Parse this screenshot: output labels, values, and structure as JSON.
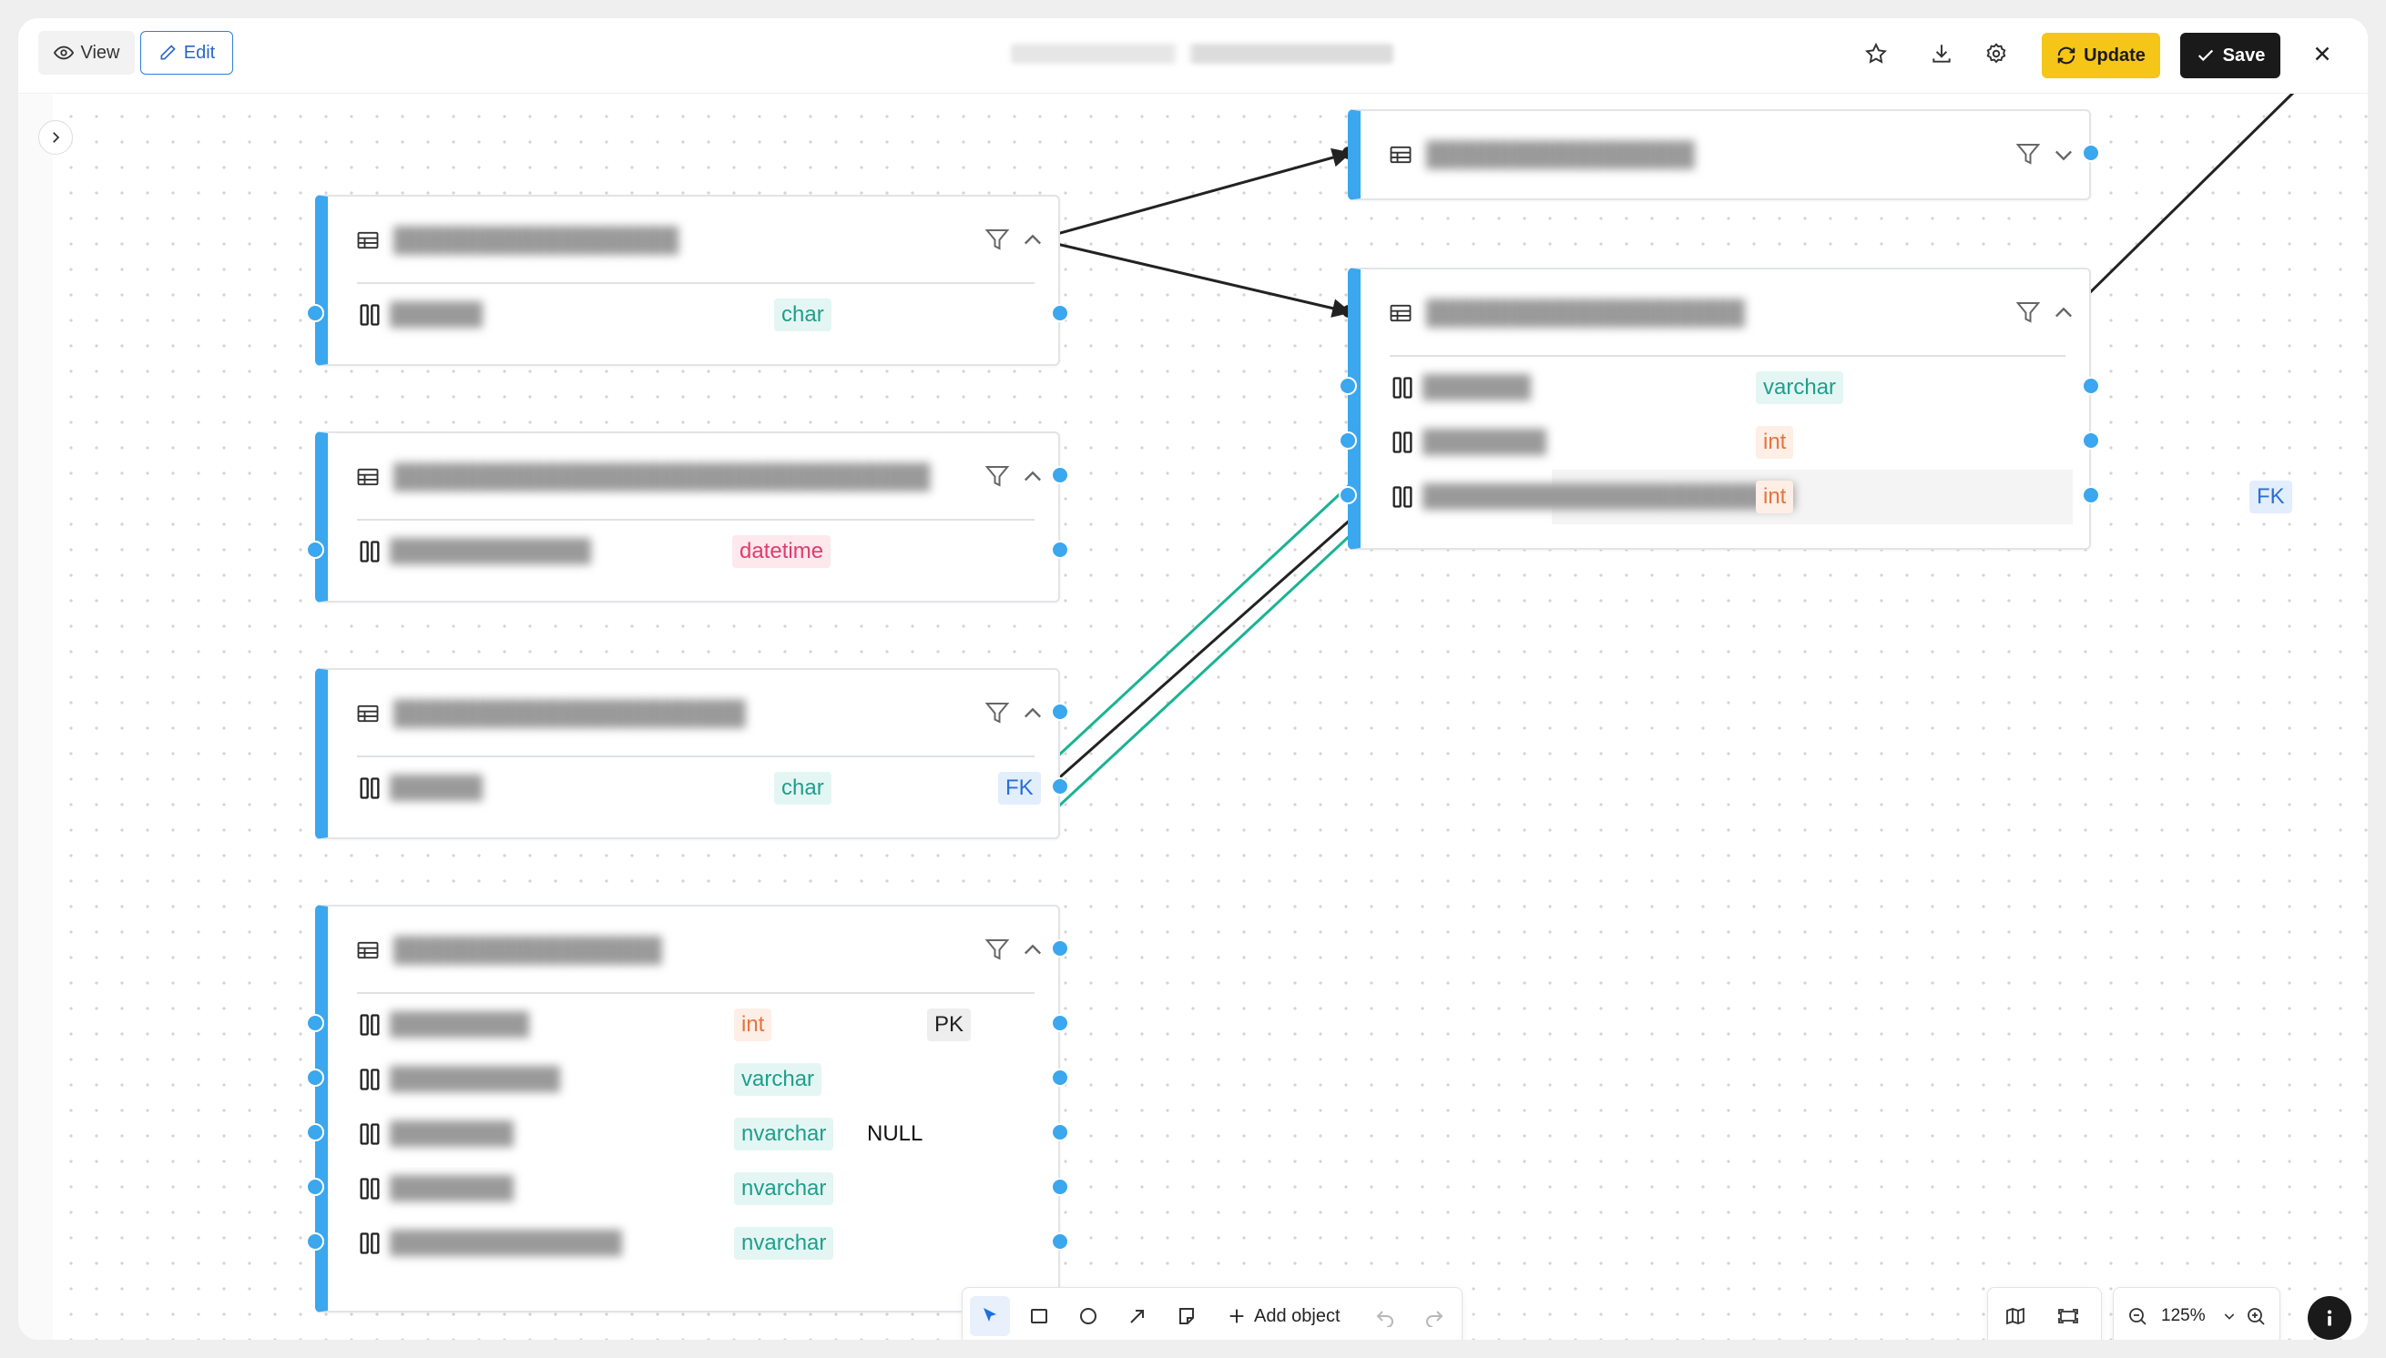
{
  "toolbar": {
    "view_label": "View",
    "edit_label": "Edit",
    "update_label": "Update",
    "save_label": "Save"
  },
  "bottom_toolbar": {
    "add_object_label": "Add object",
    "zoom_level": "125%"
  },
  "colors": {
    "accent_update": "#f5c518",
    "table_strip": "#3aa7ee",
    "selection": "#1ab394",
    "save_bg": "#1a1a1a"
  },
  "icons": [
    "eye-icon",
    "pencil-icon",
    "star-icon",
    "download-icon",
    "settings-icon",
    "refresh-icon",
    "check-icon",
    "close-icon",
    "chevron-right-icon",
    "table-icon",
    "column-icon",
    "filter-icon",
    "chevron-up-icon",
    "chevron-down-icon",
    "cursor-icon",
    "rectangle-icon",
    "circle-icon",
    "arrow-icon",
    "note-icon",
    "plus-icon",
    "undo-icon",
    "redo-icon",
    "map-icon",
    "fit-icon",
    "zoom-out-icon",
    "zoom-in-icon",
    "info-icon"
  ],
  "tables": [
    {
      "columns": [
        {
          "type": "char",
          "key": ""
        }
      ]
    },
    {
      "columns": [
        {
          "type": "datetime",
          "key": ""
        }
      ]
    },
    {
      "columns": [
        {
          "type": "char",
          "key": "FK"
        }
      ]
    },
    {
      "columns": [
        {
          "type": "int",
          "key": "PK"
        },
        {
          "type": "varchar",
          "key": ""
        },
        {
          "type": "nvarchar",
          "key": "NULL"
        },
        {
          "type": "nvarchar",
          "key": ""
        },
        {
          "type": "nvarchar",
          "key": ""
        }
      ]
    },
    {
      "collapsed": true,
      "columns": []
    },
    {
      "columns": [
        {
          "type": "varchar",
          "key": ""
        },
        {
          "type": "int",
          "key": ""
        },
        {
          "type": "int",
          "key": "FK"
        }
      ]
    }
  ]
}
